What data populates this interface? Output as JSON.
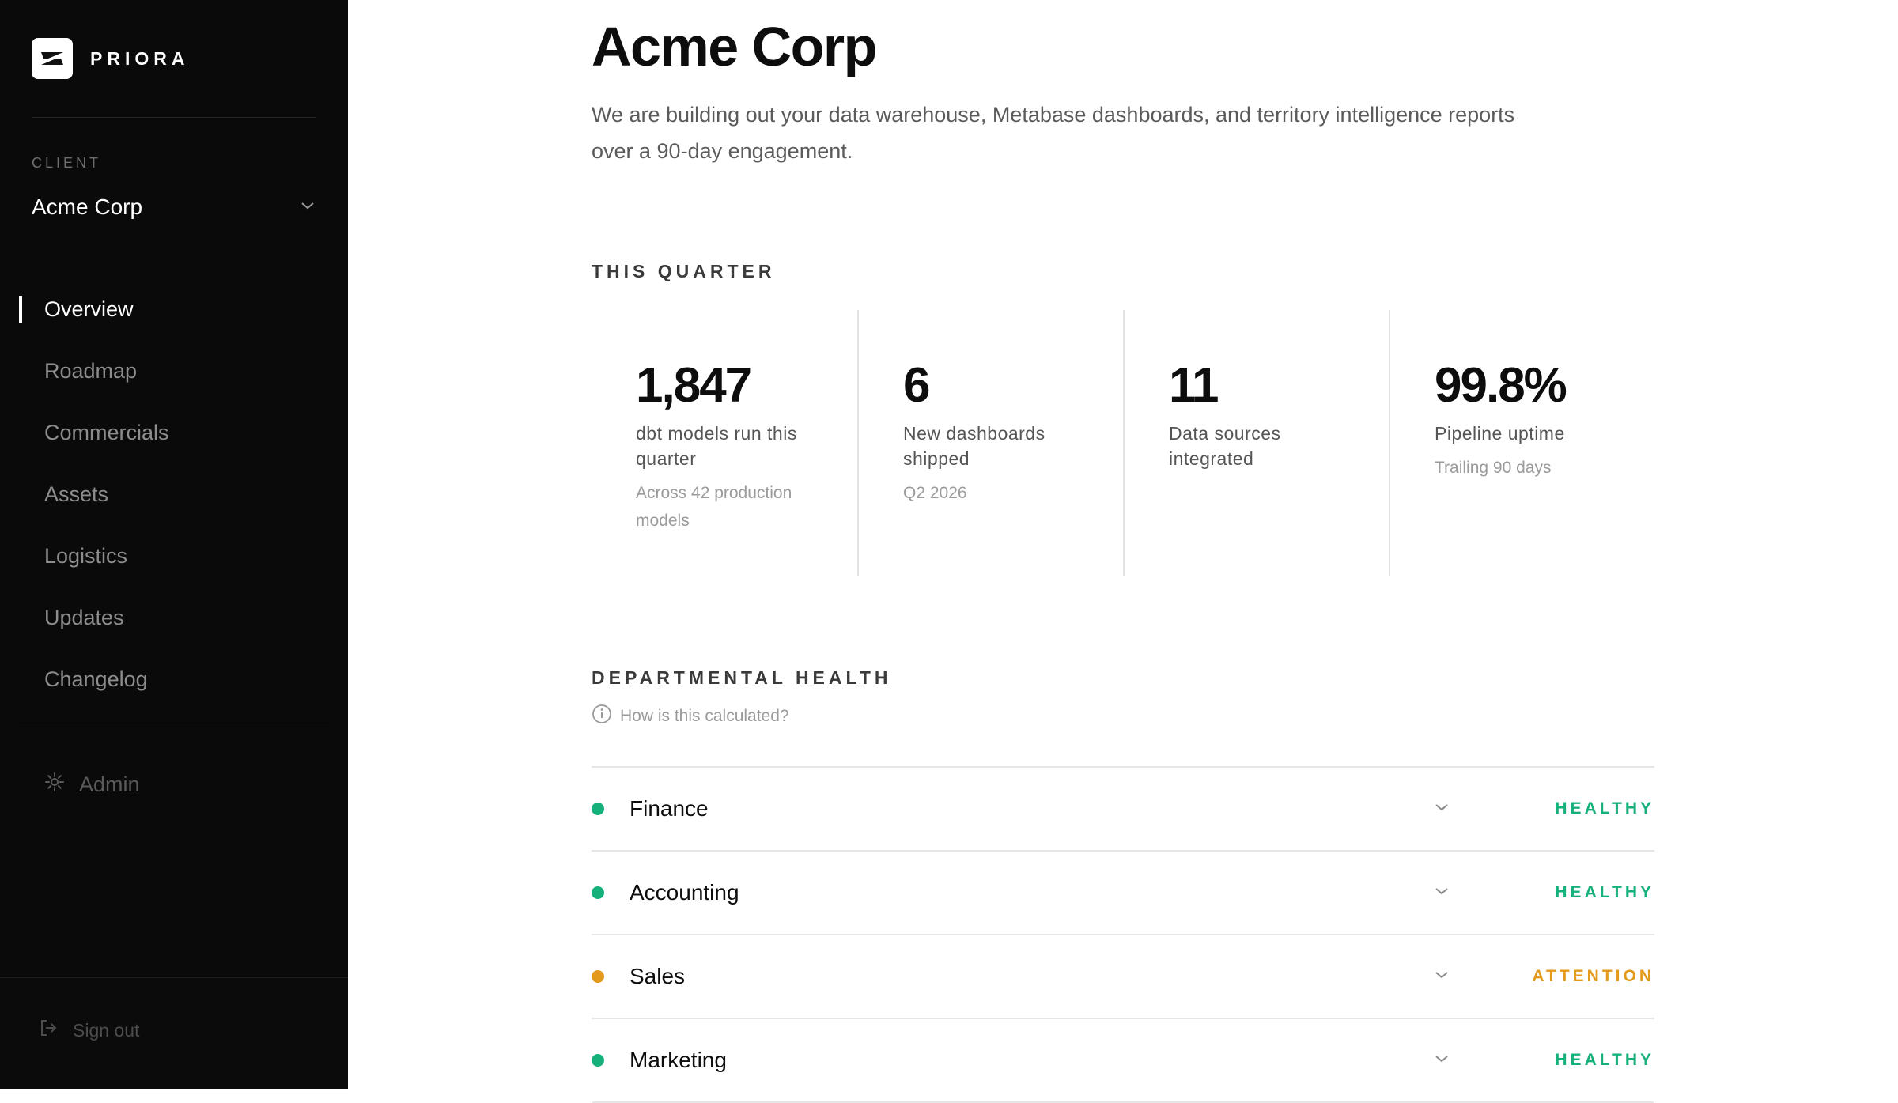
{
  "brand": {
    "name": "PRIORA"
  },
  "client": {
    "label": "CLIENT",
    "name": "Acme Corp"
  },
  "nav": {
    "items": [
      {
        "label": "Overview",
        "active": true
      },
      {
        "label": "Roadmap"
      },
      {
        "label": "Commercials"
      },
      {
        "label": "Assets"
      },
      {
        "label": "Logistics"
      },
      {
        "label": "Updates"
      },
      {
        "label": "Changelog"
      }
    ],
    "admin": "Admin",
    "signout": "Sign out"
  },
  "page": {
    "title": "Acme Corp",
    "description": "We are building out your data warehouse, Metabase dashboards, and territory intelligence reports over a 90-day engagement."
  },
  "quarter": {
    "title": "THIS QUARTER",
    "stats": [
      {
        "value": "1,847",
        "label": "dbt models run this quarter",
        "sub": "Across 42 production models"
      },
      {
        "value": "6",
        "label": "New dashboards shipped",
        "sub": "Q2 2026"
      },
      {
        "value": "11",
        "label": "Data sources integrated",
        "sub": ""
      },
      {
        "value": "99.8%",
        "label": "Pipeline uptime",
        "sub": "Trailing 90 days"
      }
    ]
  },
  "health": {
    "title": "DEPARTMENTAL HEALTH",
    "help": "How is this calculated?",
    "departments": [
      {
        "name": "Finance",
        "status": "HEALTHY",
        "color": "#16b07a"
      },
      {
        "name": "Accounting",
        "status": "HEALTHY",
        "color": "#16b07a"
      },
      {
        "name": "Sales",
        "status": "ATTENTION",
        "color": "#e39a1b"
      },
      {
        "name": "Marketing",
        "status": "HEALTHY",
        "color": "#16b07a"
      }
    ]
  },
  "colors": {
    "healthy": "#16b07a",
    "attention": "#e39a1b",
    "sidebar": "#0a0a0a"
  },
  "icons": [
    "priora-logo-icon",
    "chevron-down-icon",
    "gear-icon",
    "info-icon",
    "sign-out-icon"
  ]
}
